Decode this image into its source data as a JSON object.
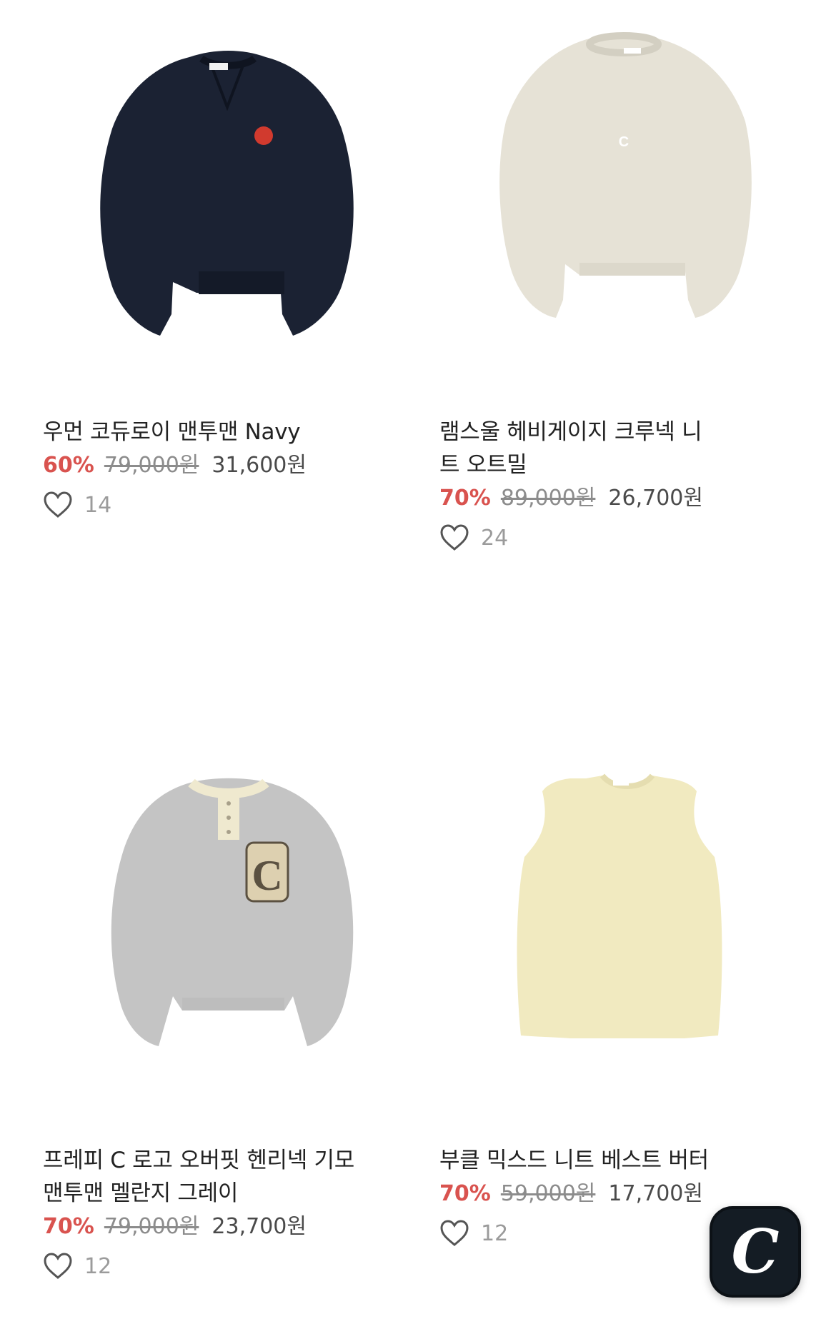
{
  "products": [
    {
      "name": "우먼 코듀로이 맨투맨 Navy",
      "discount": "60%",
      "original_price": "79,000원",
      "sale_price": "31,600원",
      "likes": "14",
      "image_color": "#1b2233",
      "logo_mark": ""
    },
    {
      "name": "램스울 헤비게이지 크루넥 니트 오트밀",
      "discount": "70%",
      "original_price": "89,000원",
      "sale_price": "26,700원",
      "likes": "24",
      "image_color": "#e6e2d6",
      "logo_mark": "C"
    },
    {
      "name": "프레피 C 로고 오버핏 헨리넥 기모 맨투맨 멜란지 그레이",
      "discount": "70%",
      "original_price": "79,000원",
      "sale_price": "23,700원",
      "likes": "12",
      "image_color": "#c4c4c4",
      "logo_mark": "C"
    },
    {
      "name": "부클 믹스드 니트 베스트 버터",
      "discount": "70%",
      "original_price": "59,000원",
      "sale_price": "17,700원",
      "likes": "12",
      "image_color": "#f1eac0",
      "logo_mark": ""
    }
  ],
  "fab": {
    "label": "C",
    "icon": "brand-logo-icon"
  },
  "colors": {
    "discount": "#d9534f",
    "muted": "#9b9b9b",
    "fab_bg": "#141c24"
  }
}
